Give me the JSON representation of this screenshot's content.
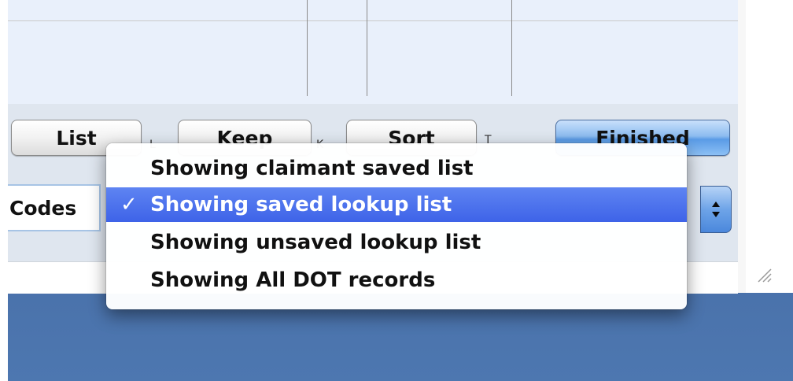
{
  "buttons": {
    "list": "List",
    "list_key": "L",
    "keep": "Keep",
    "keep_key": "K",
    "sort": "Sort",
    "sort_key": "T",
    "finished": "Finished"
  },
  "codes_field": {
    "text": "Codes"
  },
  "popup": {
    "selected_label": "Showing saved lookup list",
    "check_mark": "✓",
    "options": [
      "Showing claimant saved list",
      "Showing saved lookup list",
      "Showing unsaved lookup list",
      "Showing All DOT records"
    ],
    "selected_index": 1
  },
  "icons": {
    "popup_arrows": "up-down-arrows-icon",
    "resize": "resize-grip-icon"
  },
  "colors": {
    "menu_highlight": "#3e63e8",
    "default_button": "#5a9be6",
    "desktop": "#3a5f96"
  }
}
